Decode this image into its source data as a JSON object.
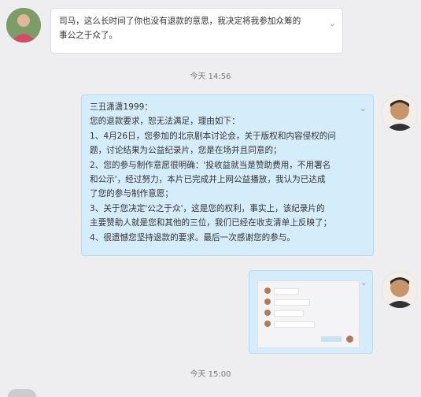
{
  "messages": {
    "incoming": {
      "lines": [
        "司马，这么长时间了你也没有退款的意思，我决定将我参加众筹的",
        "事公之于众了。"
      ]
    },
    "timestamp1": "今天 14:56",
    "reply": {
      "lines": [
        "三丑潇潇1999：",
        "您的退款要求，恕无法满足，理由如下：",
        "1、4月26日，您参加的北京剧本讨论会，关于版权和内容侵权的问",
        "题，讨论结果为公益纪录片，您是在场并且同意的；",
        "2、您的参与制作意愿很明确：'投收益就当是赞助费用，不用署名",
        "和公示'，经过努力，本片已完成并上网公益播放，我认为已达成",
        "了您的参与制作意愿；",
        "3、关于您决定'公之于众'，这是您的权利，事实上，该纪录片的",
        "主要赞助人就是您和其他的三位，我们已经在收支清单上反映了；",
        "4、很遗憾您坚持退款的要求。最后一次感谢您的参与。"
      ]
    },
    "timestamp2": "今天 15:00"
  },
  "colors": {
    "background": "#eeeef0",
    "incoming_bubble": "#ffffff",
    "outgoing_bubble": "#d5ecfa"
  },
  "icons": {
    "bubble_menu": "chevron-down-icon"
  }
}
